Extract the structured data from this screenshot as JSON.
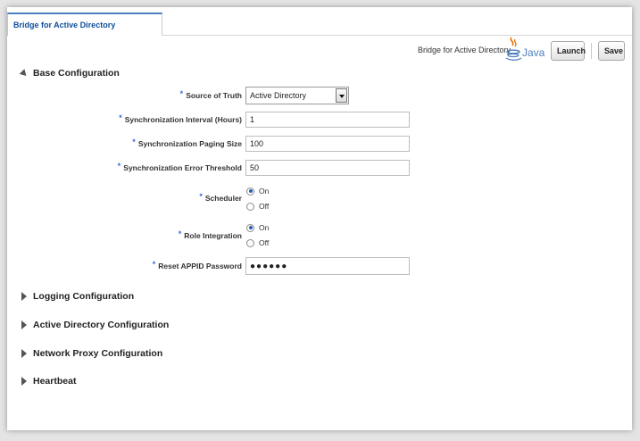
{
  "tab": {
    "label": "Bridge for Active Directory"
  },
  "toolbar": {
    "app_label": "Bridge for Active Directory",
    "logo_icon": "java-logo-icon",
    "logo_text": "Java",
    "launch_label": "Launch",
    "save_label": "Save"
  },
  "base_config": {
    "title": "Base Configuration",
    "fields": {
      "source_of_truth": {
        "label": "Source of Truth",
        "value": "Active Directory"
      },
      "sync_interval": {
        "label": "Synchronization Interval (Hours)",
        "value": "1"
      },
      "sync_paging": {
        "label": "Synchronization Paging Size",
        "value": "100"
      },
      "sync_error": {
        "label": "Synchronization Error Threshold",
        "value": "50"
      },
      "scheduler": {
        "label": "Scheduler",
        "options": [
          "On",
          "Off"
        ],
        "selected": "On"
      },
      "role_integration": {
        "label": "Role Integration",
        "options": [
          "On",
          "Off"
        ],
        "selected": "On"
      },
      "reset_password": {
        "label": "Reset APPID Password",
        "value": "●●●●●●"
      }
    },
    "required_marker": "*"
  },
  "sections": {
    "logging": "Logging Configuration",
    "active_directory": "Active Directory Configuration",
    "network_proxy": "Network Proxy Configuration",
    "heartbeat": "Heartbeat"
  },
  "colors": {
    "tab_text": "#0e4e9c",
    "tab_accent": "#4a7fc1",
    "required": "#3a6fd6",
    "java_blue": "#4d7fbe",
    "java_orange": "#e76f00"
  }
}
